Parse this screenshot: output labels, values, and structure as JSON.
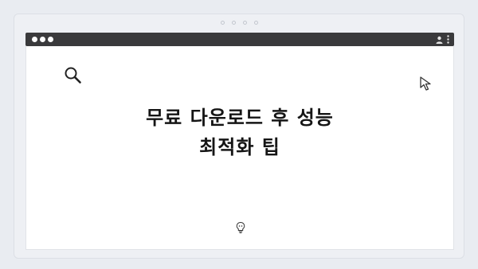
{
  "window": {
    "controls": [
      "window-dot",
      "window-dot",
      "window-dot"
    ],
    "toolbar_icons": [
      "account-icon",
      "more-vertical-icon"
    ]
  },
  "pager": {
    "dots": 4
  },
  "main": {
    "headline_line1": "무료 다운로드 후 성능",
    "headline_line2": "최적화 팁",
    "icons": [
      "search-icon",
      "cursor-icon",
      "lightbulb-icon"
    ]
  },
  "colors": {
    "page_background": "#e9ecf1",
    "browser_bar": "#3a3a3c",
    "content_background": "#ffffff",
    "headline_text": "#151515"
  }
}
